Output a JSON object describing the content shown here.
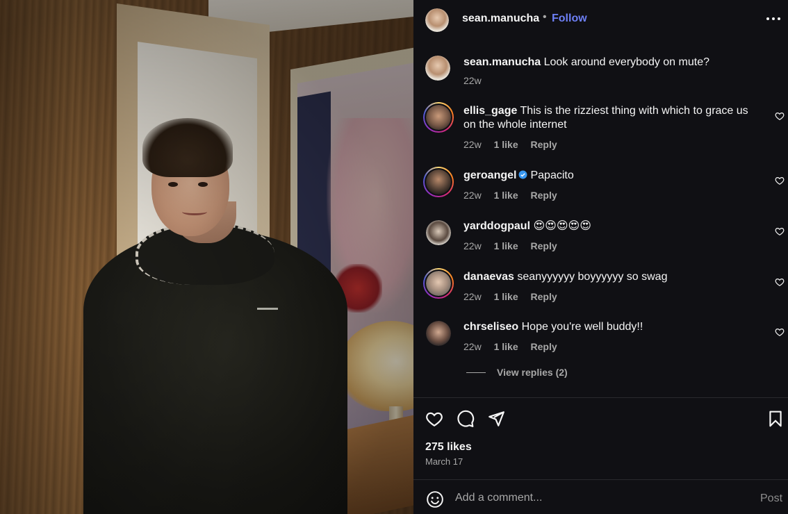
{
  "header": {
    "username": "sean.manucha",
    "separator": "•",
    "follow_label": "Follow",
    "more_icon": "more-horizontal-icon"
  },
  "comments": [
    {
      "username": "sean.manucha",
      "text": "Look around everybody on mute?",
      "time": "22w",
      "likes": "",
      "reply": "",
      "verified": false,
      "story_ring": false
    },
    {
      "username": "ellis_gage",
      "text": "This is the rizziest thing with which to grace us on the whole internet",
      "time": "22w",
      "likes": "1 like",
      "reply": "Reply",
      "verified": false,
      "story_ring": true
    },
    {
      "username": "geroangel",
      "text": "Papacito",
      "time": "22w",
      "likes": "1 like",
      "reply": "Reply",
      "verified": true,
      "story_ring": true
    },
    {
      "username": "yarddogpaul",
      "text": "😍😍😍😍😍",
      "time": "22w",
      "likes": "1 like",
      "reply": "Reply",
      "verified": false,
      "story_ring": false
    },
    {
      "username": "danaevas",
      "text": "seanyyyyyy boyyyyyy so swag",
      "time": "22w",
      "likes": "1 like",
      "reply": "Reply",
      "verified": false,
      "story_ring": true
    },
    {
      "username": "chrseliseo",
      "text": "Hope you're well buddy!!",
      "time": "22w",
      "likes": "1 like",
      "reply": "Reply",
      "verified": false,
      "story_ring": false
    }
  ],
  "view_replies_label": "View replies (2)",
  "actions": {
    "like_icon": "heart-icon",
    "comment_icon": "comment-icon",
    "share_icon": "share-icon",
    "save_icon": "bookmark-icon"
  },
  "likes_text": "275 likes",
  "date_text": "March 17",
  "composer": {
    "emoji_icon": "emoji-icon",
    "placeholder": "Add a comment...",
    "post_label": "Post"
  },
  "colors": {
    "panel_bg": "#101014",
    "text": "#f5f5f5",
    "muted": "#a8a8a8",
    "link_blue": "#6d7ff5",
    "verified_blue": "#3897f0"
  }
}
